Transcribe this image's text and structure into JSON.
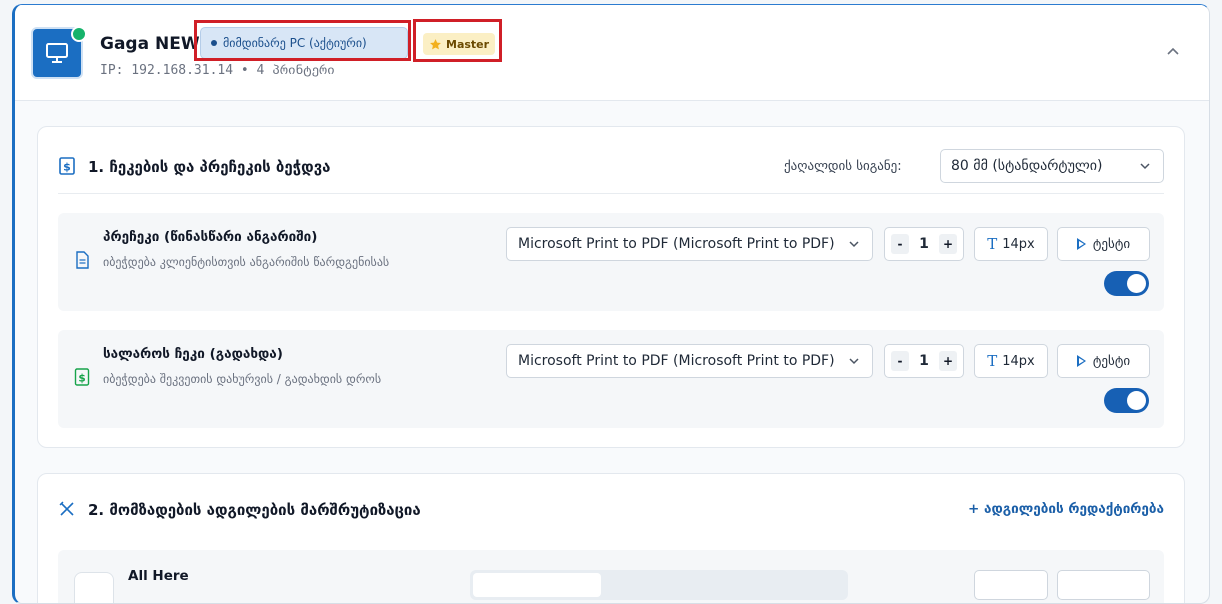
{
  "header": {
    "device_name": "Gaga NEW",
    "current_badge": "მიმდინარე PC (აქტიური)",
    "master_badge": "Master",
    "subline": "IP: 192.168.31.14 • 4 პრინტერი",
    "status_color": "#16b36b",
    "accent_color": "#1b6ec2"
  },
  "section1": {
    "title": "1. ჩეკების და პრეჩეკის ბეჭდვა",
    "paper_label": "ქაღალდის სიგანე:",
    "paper_value": "80 მმ (სტანდარტული)",
    "rows": [
      {
        "title": "პრეჩეკი (წინასწარი ანგარიში)",
        "desc": "იბეჭდება კლიენტისთვის ანგარიშის წარდგენისას",
        "printer": "Microsoft Print to PDF (Microsoft Print to PDF)",
        "minus": "-",
        "copies": "1",
        "plus": "+",
        "font_size": "14px",
        "test_label": "ტესტი",
        "enabled": true
      },
      {
        "title": "სალაროს ჩეკი (გადახდა)",
        "desc": "იბეჭდება შეკვეთის დახურვის / გადახდის დროს",
        "printer": "Microsoft Print to PDF (Microsoft Print to PDF)",
        "minus": "-",
        "copies": "1",
        "plus": "+",
        "font_size": "14px",
        "test_label": "ტესტი",
        "enabled": true
      }
    ]
  },
  "section2": {
    "title": "2. მომზადების ადგილების მარშრუტიზაცია",
    "add_link": "+ ადგილების რედაქტირება",
    "destination": "All Here"
  }
}
